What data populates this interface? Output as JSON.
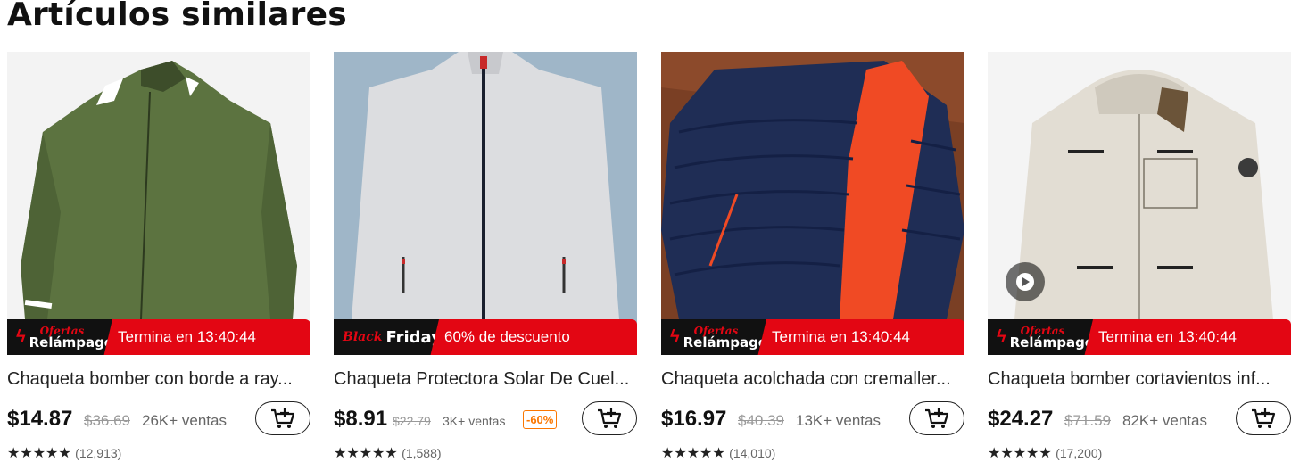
{
  "section_title": "Artículos similares",
  "products": [
    {
      "name": "Chaqueta bomber con borde a ray...",
      "banner": {
        "type": "ofertas",
        "tag_top": "Ofertas",
        "tag_bottom": "Relámpago",
        "text": "Termina en 13:40:44"
      },
      "price": "$14.87",
      "old_price": "$36.69",
      "sales": "26K+ ventas",
      "discount": "",
      "rating_stars": "★★★★★",
      "rating_count": "(12,913)",
      "cart_icon": "add-to-cart-icon"
    },
    {
      "name": "Chaqueta Protectora Solar De Cuel...",
      "banner": {
        "type": "blackfriday",
        "tag_top": "Black",
        "tag_bottom": "Friday",
        "text": "60% de descuento"
      },
      "price": "$8.91",
      "old_price": "$22.79",
      "sales": "3K+ ventas",
      "discount": "-60%",
      "rating_stars": "★★★★★",
      "rating_count": "(1,588)",
      "cart_icon": "add-to-cart-icon"
    },
    {
      "name": "Chaqueta acolchada con cremaller...",
      "banner": {
        "type": "ofertas",
        "tag_top": "Ofertas",
        "tag_bottom": "Relámpago",
        "text": "Termina en 13:40:44"
      },
      "price": "$16.97",
      "old_price": "$40.39",
      "sales": "13K+ ventas",
      "discount": "",
      "rating_stars": "★★★★★",
      "rating_count": "(14,010)",
      "cart_icon": "add-to-cart-icon"
    },
    {
      "name": "Chaqueta bomber cortavientos inf...",
      "banner": {
        "type": "ofertas",
        "tag_top": "Ofertas",
        "tag_bottom": "Relámpago",
        "text": "Termina en 13:40:44"
      },
      "price": "$24.27",
      "old_price": "$71.59",
      "sales": "82K+ ventas",
      "discount": "",
      "rating_stars": "★★★★★",
      "rating_count": "(17,200)",
      "cart_icon": "add-to-cart-icon",
      "has_video": true
    }
  ],
  "colors": {
    "accent_red": "#e30613",
    "discount_orange": "#fb7701"
  }
}
